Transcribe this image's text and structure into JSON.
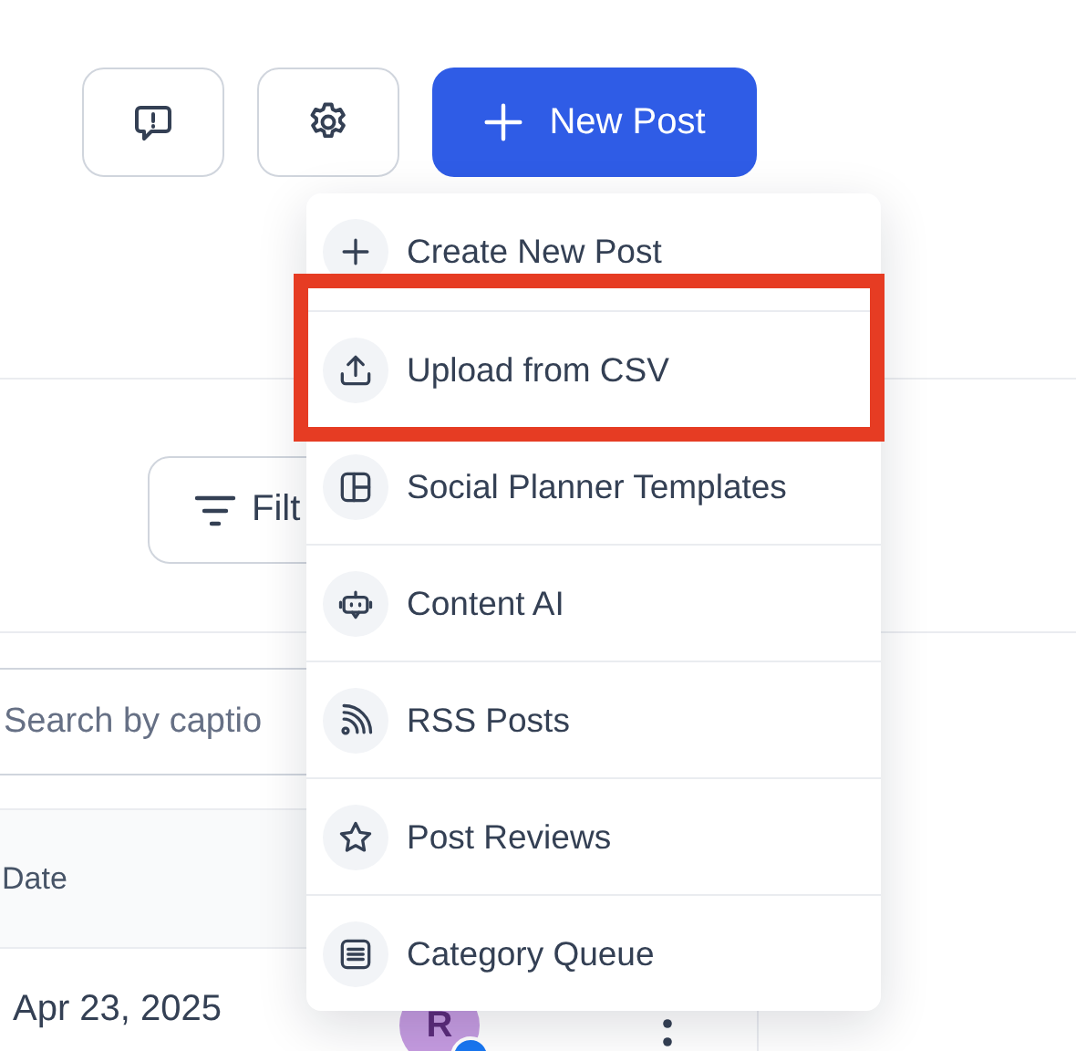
{
  "toolbar": {
    "new_post_button": {
      "label": "New Post"
    }
  },
  "filter_button": {
    "label": "Filt"
  },
  "search": {
    "placeholder": "Search by captio"
  },
  "table": {
    "columns": [
      {
        "label": "Date"
      }
    ],
    "rows": [
      {
        "date": "Apr 23, 2025",
        "avatar": "R"
      }
    ]
  },
  "menu": {
    "items": [
      {
        "label": "Create New Post",
        "highlighted": false
      },
      {
        "label": "Upload from CSV",
        "highlighted": true
      },
      {
        "label": "Social Planner Templates",
        "highlighted": false
      },
      {
        "label": "Content AI",
        "highlighted": false
      },
      {
        "label": "RSS Posts",
        "highlighted": false
      },
      {
        "label": "Post Reviews",
        "highlighted": false
      },
      {
        "label": "Category Queue",
        "highlighted": false
      }
    ]
  }
}
